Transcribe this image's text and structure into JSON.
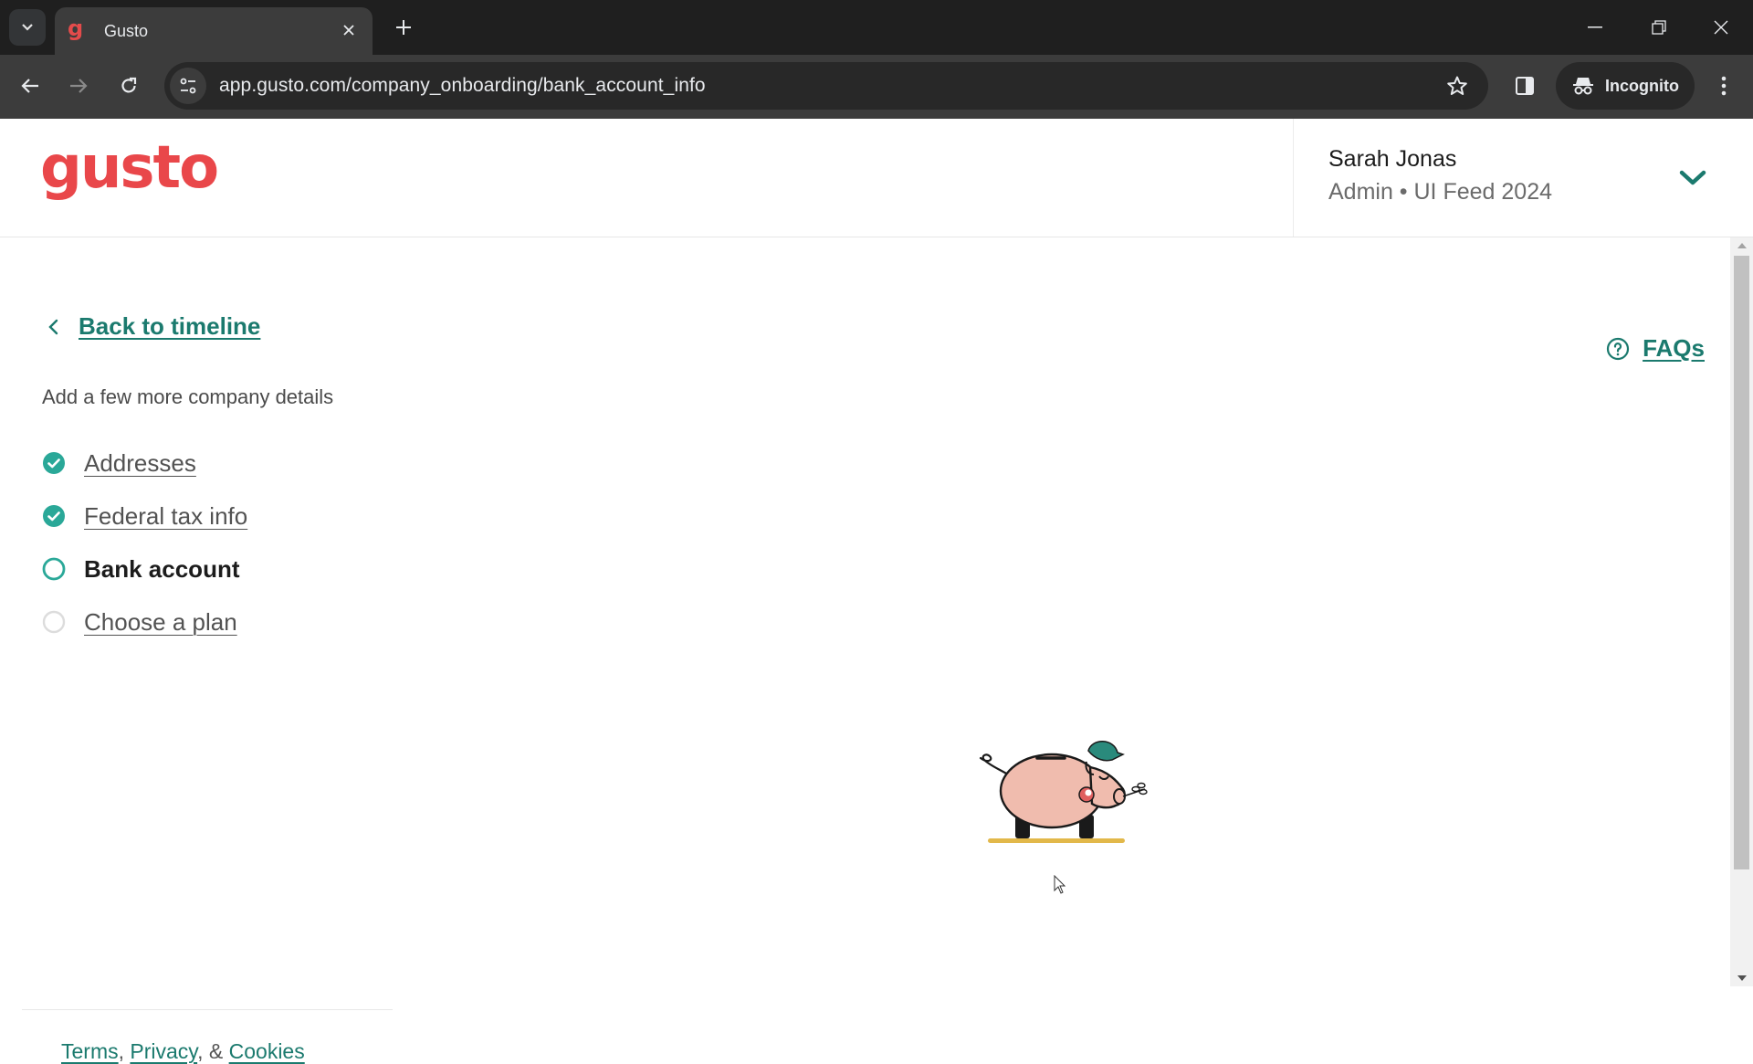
{
  "browser": {
    "tab_title": "Gusto",
    "tab_favicon": "g",
    "url": "app.gusto.com/company_onboarding/bank_account_info",
    "profile_label": "Incognito",
    "icons": {
      "tab_search": "chevron-down-icon",
      "tab_close": "close-icon",
      "new_tab": "plus-icon",
      "back": "arrow-left-icon",
      "forward": "arrow-right-icon",
      "reload": "reload-icon",
      "site_info": "tune-icon",
      "bookmark": "star-icon",
      "side_panel": "side-panel-icon",
      "incognito": "incognito-icon",
      "menu": "kebab-menu-icon",
      "minimize": "minimize-icon",
      "restore": "restore-icon",
      "close_window": "close-icon"
    }
  },
  "header": {
    "logo_text": "gusto",
    "account": {
      "name": "Sarah Jonas",
      "subtitle": "Admin • UI Feed 2024"
    }
  },
  "main": {
    "back_link": "Back to timeline",
    "section_title": "Add a few more company details",
    "steps": [
      {
        "label": "Addresses",
        "status": "complete"
      },
      {
        "label": "Federal tax info",
        "status": "complete"
      },
      {
        "label": "Bank account",
        "status": "current"
      },
      {
        "label": "Choose a plan",
        "status": "incomplete"
      }
    ],
    "faqs_label": "FAQs",
    "illustration": "piggy-bank-illustration"
  },
  "footer": {
    "terms": "Terms",
    "sep1": ",",
    "privacy": "Privacy",
    "sep2": ", &",
    "cookies": "Cookies"
  },
  "colors": {
    "brand": "#e9474a",
    "accent": "#1b7a6e",
    "step_complete": "#2aa898"
  }
}
